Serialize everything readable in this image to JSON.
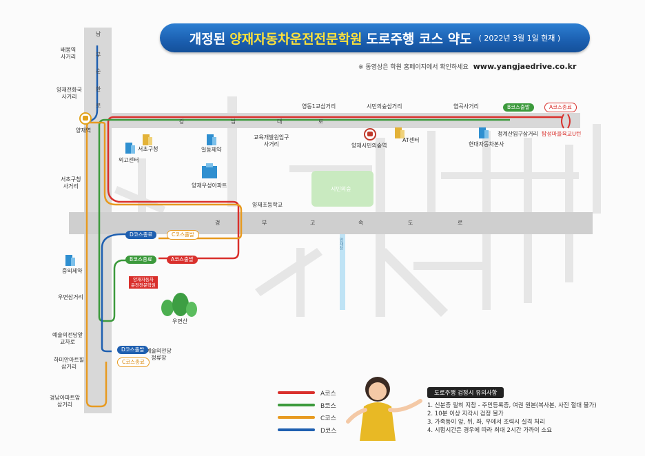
{
  "header": {
    "title_pre": "개정된",
    "title_highlight": "양재자동차운전전문학원",
    "title_post": "도로주행 코스 약도",
    "date": "( 2022년 3월 1일 현재 )"
  },
  "note": {
    "text": "※ 동영상은 학원 홈페이지에서 확인하세요",
    "url": "www.yangjaedrive.co.kr"
  },
  "roads": {
    "vertical_chars": [
      "남",
      "부",
      "순",
      "환",
      "로"
    ],
    "horizontal_chars": [
      "강",
      "남",
      "대",
      "로"
    ],
    "expressway_chars": [
      "경",
      "부",
      "고",
      "속",
      "도",
      "로"
    ],
    "stream": "양재천"
  },
  "left_places": [
    {
      "text": "배봉역\n사거리"
    },
    {
      "text": "양재전화국\n사거리"
    },
    {
      "text": "양재역"
    },
    {
      "text": "서초구청\n사거리"
    },
    {
      "text": "우면삼거리"
    },
    {
      "text": "예술의전당앞\n교차로"
    },
    {
      "text": "하미안아트힐\n삼거리"
    },
    {
      "text": "경남아파트앞\n삼거리"
    }
  ],
  "top_places": {
    "youngdong": "영동1교삼거리",
    "citizen_forest": "시민의숲삼거리",
    "yeomgok": "염곡사거리",
    "cheonggye": "청계산입구삼거리",
    "tapsung": "탑성마을육교U턴"
  },
  "landmarks": {
    "seocho_office": "서초구청",
    "oego": "외고센터",
    "ildong": "일동제약",
    "education": "교육개발원입구\n사거리",
    "woosung": "양재우성아파트",
    "citizen_station": "양재시민의숲역",
    "at_center": "AT센터",
    "hyundai": "현대자동차본사",
    "forest": "시민의숲",
    "school": "양재초등학교",
    "junghwa": "중외제약",
    "umyeon": "우면산",
    "arts_center": "예술의전당\n정류장",
    "academy": "양재자동차\n운전전문학원"
  },
  "badges": {
    "b_start_top": "B코스출발",
    "a_end_top": "A코스종료",
    "d_end": "D코스종료",
    "c_start": "C코스출발",
    "b_end": "B코스종료",
    "a_start": "A코스출발",
    "d_start": "D코스출발",
    "c_end": "C코스종료"
  },
  "legend": [
    {
      "label": "A코스",
      "color": "#d9302c"
    },
    {
      "label": "B코스",
      "color": "#3c9a3c"
    },
    {
      "label": "C코스",
      "color": "#e79a20"
    },
    {
      "label": "D코스",
      "color": "#1e5fb0"
    }
  ],
  "notice": {
    "title": "도로주행 검정시 유의사항",
    "items": [
      "1. 신분증 필히 지참 - 주민등록증, 여권 원본(복사본, 사진 절대 불가)",
      "2. 10분 이상 지각시 검정 불가",
      "3. 가족등이 앞, 뒤, 좌, 우에서 조력시 실격 처리",
      "4. 시험시간은 경우에 따라 최대 2시간 가까이 소요"
    ]
  }
}
